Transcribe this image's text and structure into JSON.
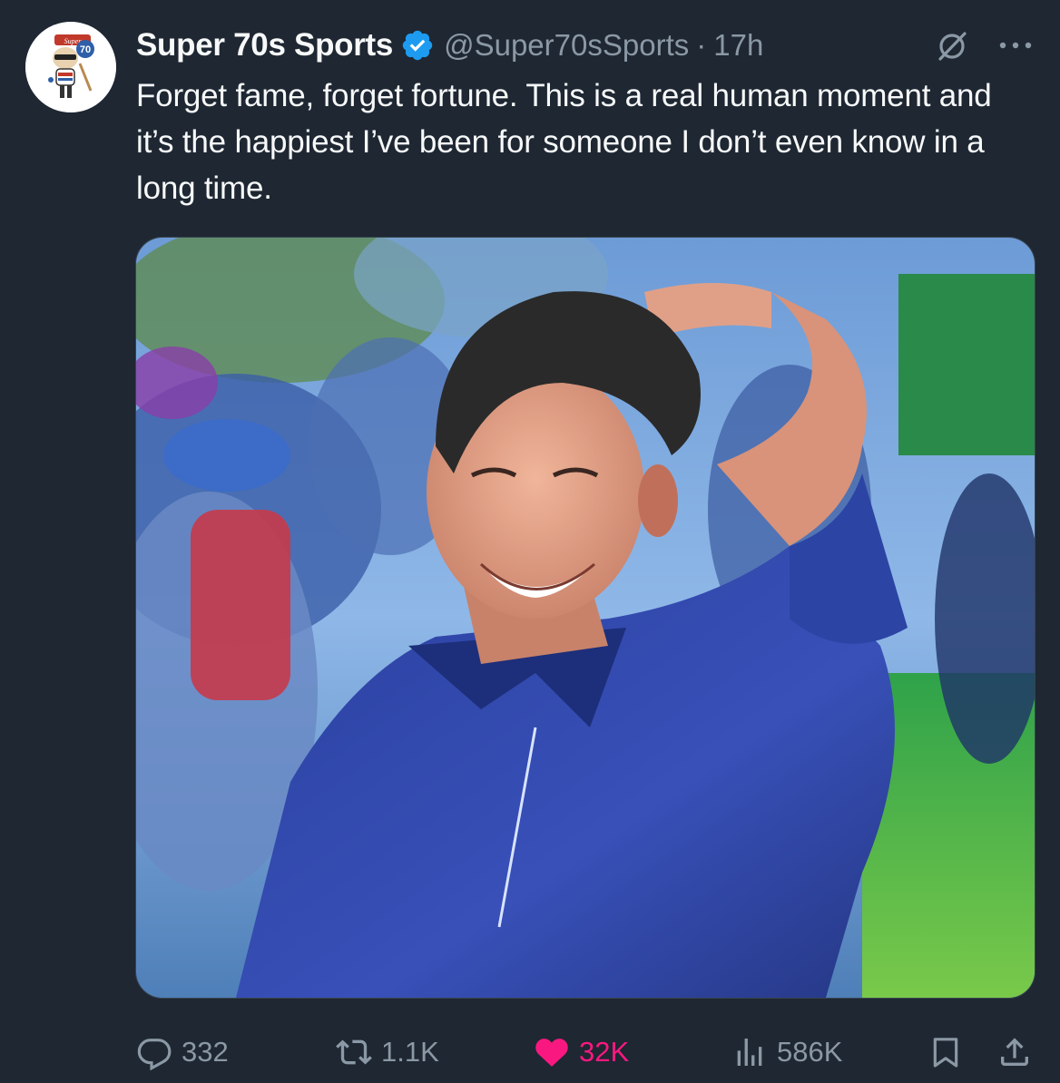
{
  "tweet": {
    "author_name": "Super 70s Sports",
    "author_handle": "@Super70sSports",
    "separator": "·",
    "time": "17h",
    "text": "Forget fame, forget fortune. This is a real human moment and it’s the happiest I’ve been for someone I don’t even know in a long time.",
    "avatar_text": "Super 70s"
  },
  "actions": {
    "replies": "332",
    "reposts": "1.1K",
    "likes": "32K",
    "views": "586K"
  },
  "colors": {
    "background": "#1e2732",
    "text": "#f7f9f9",
    "secondary": "#8b98a5",
    "verified": "#1d9bf0",
    "like": "#f91880"
  },
  "icons": [
    "verified-badge-icon",
    "grok-icon",
    "more-icon",
    "reply-icon",
    "repost-icon",
    "like-icon",
    "views-icon",
    "bookmark-icon",
    "share-icon"
  ]
}
